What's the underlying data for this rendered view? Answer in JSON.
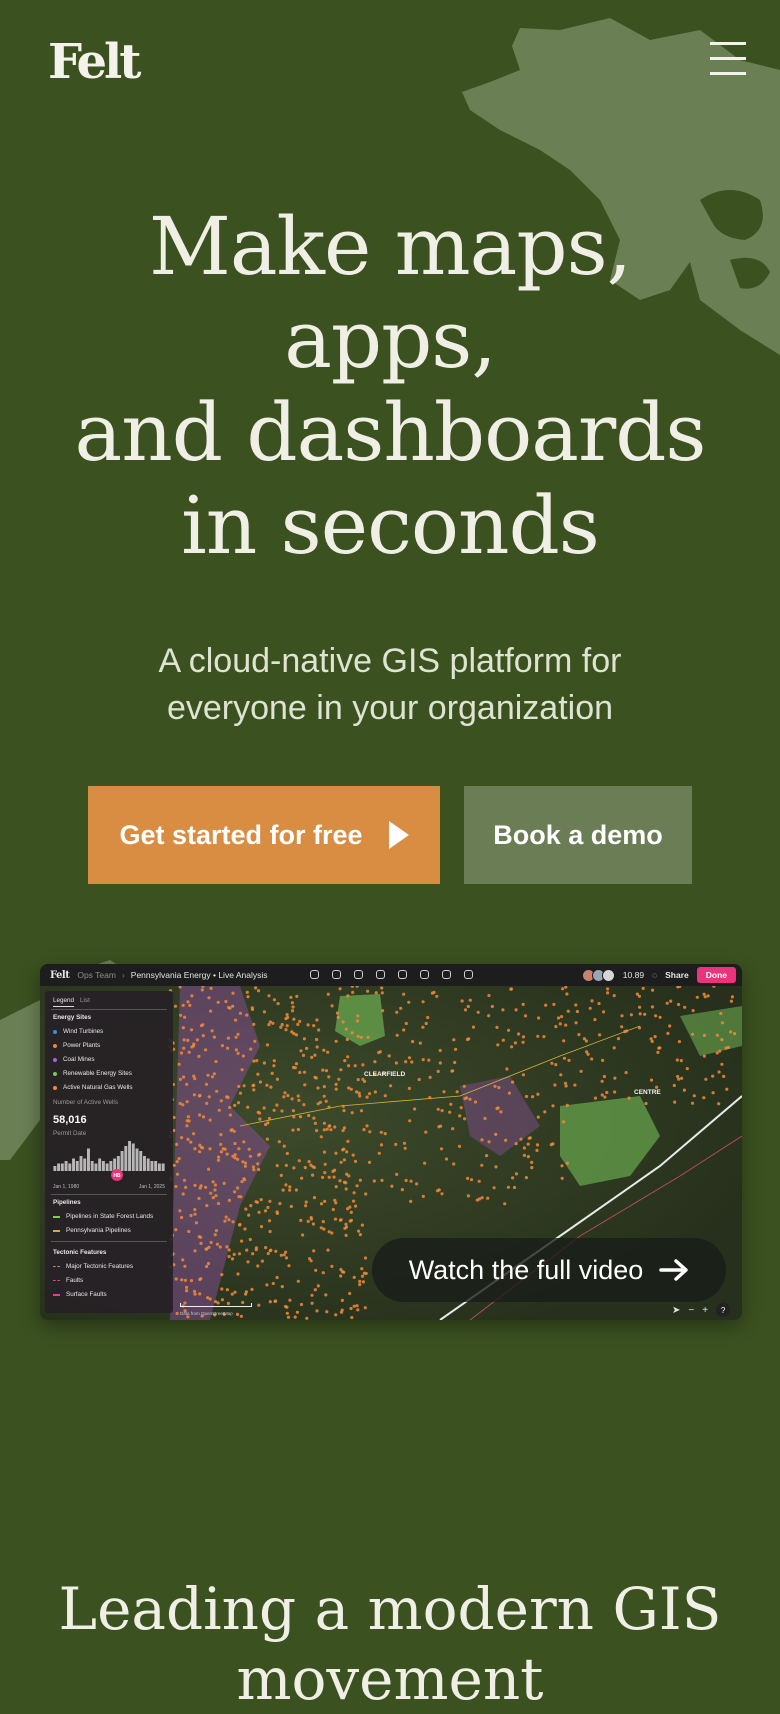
{
  "header": {
    "logo": "Felt",
    "menu_icon": "hamburger-menu-icon"
  },
  "hero": {
    "title_lines": [
      "Make maps,",
      "apps,",
      "and dashboards",
      "in seconds"
    ],
    "subtitle_lines": [
      "A cloud-native GIS platform for",
      "everyone in your organization"
    ],
    "primary_cta": "Get started for free",
    "secondary_cta": "Book a demo"
  },
  "app_preview": {
    "topbar": {
      "logo": "Felt",
      "team": "Ops Team",
      "separator": "›",
      "title": "Pennsylvania Energy • Live Analysis",
      "zoom": "10.89",
      "share": "Share",
      "done": "Done"
    },
    "legend": {
      "tabs": [
        "Legend",
        "List"
      ],
      "energy_sites": {
        "title": "Energy Sites",
        "items": [
          {
            "label": "Wind Turbines",
            "color": "#3b8fd9"
          },
          {
            "label": "Power Plants",
            "color": "#e38b3c"
          },
          {
            "label": "Coal Mines",
            "color": "#b35be0"
          },
          {
            "label": "Renewable Energy Sites",
            "color": "#7cc65a"
          },
          {
            "label": "Active Natural Gas Wells",
            "color": "#f08a3a"
          }
        ]
      },
      "metric_label": "Number of Active Wells",
      "metric_value": "58,016",
      "permit_label": "Permit Date",
      "histogram": [
        2,
        3,
        3,
        4,
        3,
        5,
        4,
        6,
        5,
        9,
        4,
        3,
        5,
        4,
        3,
        4,
        5,
        6,
        8,
        10,
        12,
        11,
        9,
        8,
        6,
        5,
        4,
        4,
        3,
        3
      ],
      "marker": "HB",
      "date_start": "Jan 1, 1980",
      "date_end": "Jan 1, 2025",
      "pipelines": {
        "title": "Pipelines",
        "items": [
          {
            "label": "Pipelines in State Forest Lands",
            "color": "#7cd24a"
          },
          {
            "label": "Pennsylvania Pipelines",
            "color": "#e0a63c"
          }
        ]
      },
      "tectonic": {
        "title": "Tectonic Features",
        "items": [
          {
            "label": "Major Tectonic Features",
            "color": "#e07f5a"
          },
          {
            "label": "Faults",
            "color": "#e0458a"
          },
          {
            "label": "Surface Faults",
            "color": "#e83a9b"
          }
        ]
      }
    },
    "places": [
      "CLEARFIELD",
      "CENTRE"
    ],
    "watch_label": "Watch the full video",
    "controls": {
      "zoom_out": "−",
      "zoom_in": "+",
      "help": "?"
    },
    "attribution": "Data from OpenStreetMap"
  },
  "section": {
    "title_lines": [
      "Leading a modern GIS",
      "movement"
    ]
  },
  "colors": {
    "background": "#3b5120",
    "accent": "#d98d43",
    "secondary": "#6a7d55",
    "done": "#e8347a"
  }
}
